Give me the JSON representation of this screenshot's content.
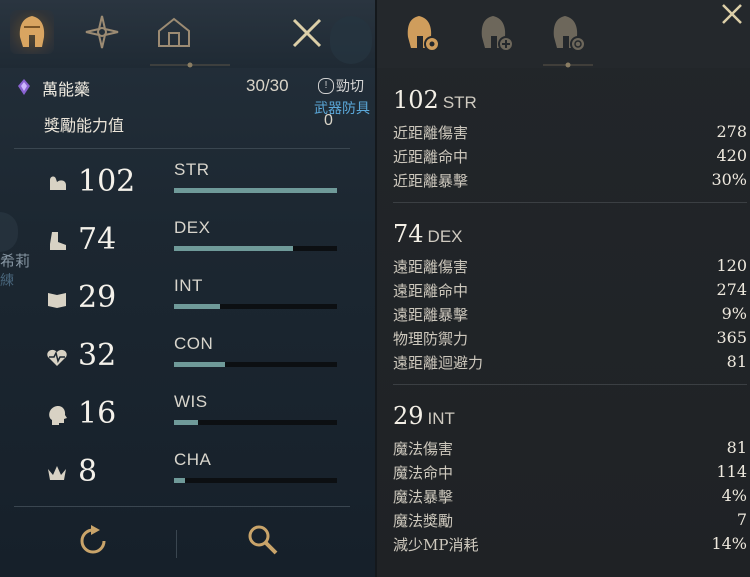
{
  "left_panel": {
    "potion": {
      "name": "萬能藥",
      "count": "30/30"
    },
    "hint": {
      "text": "勁切",
      "sub": "武器防具"
    },
    "bonus": {
      "label": "獎勵能力值",
      "value": "0"
    },
    "side_labels": {
      "name": "希莉",
      "sub": "練"
    },
    "stats": [
      {
        "abbr": "STR",
        "value": "102",
        "bar": 1.0,
        "icon": "flexed-arm-icon"
      },
      {
        "abbr": "DEX",
        "value": "74",
        "bar": 0.73,
        "icon": "boot-icon"
      },
      {
        "abbr": "INT",
        "value": "29",
        "bar": 0.28,
        "icon": "book-icon"
      },
      {
        "abbr": "CON",
        "value": "32",
        "bar": 0.31,
        "icon": "heartbeat-icon"
      },
      {
        "abbr": "WIS",
        "value": "16",
        "bar": 0.15,
        "icon": "head-icon"
      },
      {
        "abbr": "CHA",
        "value": "8",
        "bar": 0.07,
        "icon": "crown-icon"
      }
    ]
  },
  "right_panel": {
    "sections": [
      {
        "num": "102",
        "abbr": "STR",
        "lines": [
          {
            "label": "近距離傷害",
            "value": "278"
          },
          {
            "label": "近距離命中",
            "value": "420"
          },
          {
            "label": "近距離暴擊",
            "value": "30%"
          }
        ]
      },
      {
        "num": "74",
        "abbr": "DEX",
        "lines": [
          {
            "label": "遠距離傷害",
            "value": "120"
          },
          {
            "label": "遠距離命中",
            "value": "274"
          },
          {
            "label": "遠距離暴擊",
            "value": "9%"
          },
          {
            "label": "物理防禦力",
            "value": "365"
          },
          {
            "label": "遠距離迴避力",
            "value": "81"
          }
        ]
      },
      {
        "num": "29",
        "abbr": "INT",
        "lines": [
          {
            "label": "魔法傷害",
            "value": "81"
          },
          {
            "label": "魔法命中",
            "value": "114"
          },
          {
            "label": "魔法暴擊",
            "value": "4%"
          },
          {
            "label": "魔法獎勵",
            "value": "7"
          },
          {
            "label": "減少MP消耗",
            "value": "14%"
          }
        ]
      }
    ]
  },
  "colors": {
    "bar_fill": "#6f9a99",
    "accent_gold": "#c9a46a",
    "hint_blue": "#5aa7d8"
  }
}
